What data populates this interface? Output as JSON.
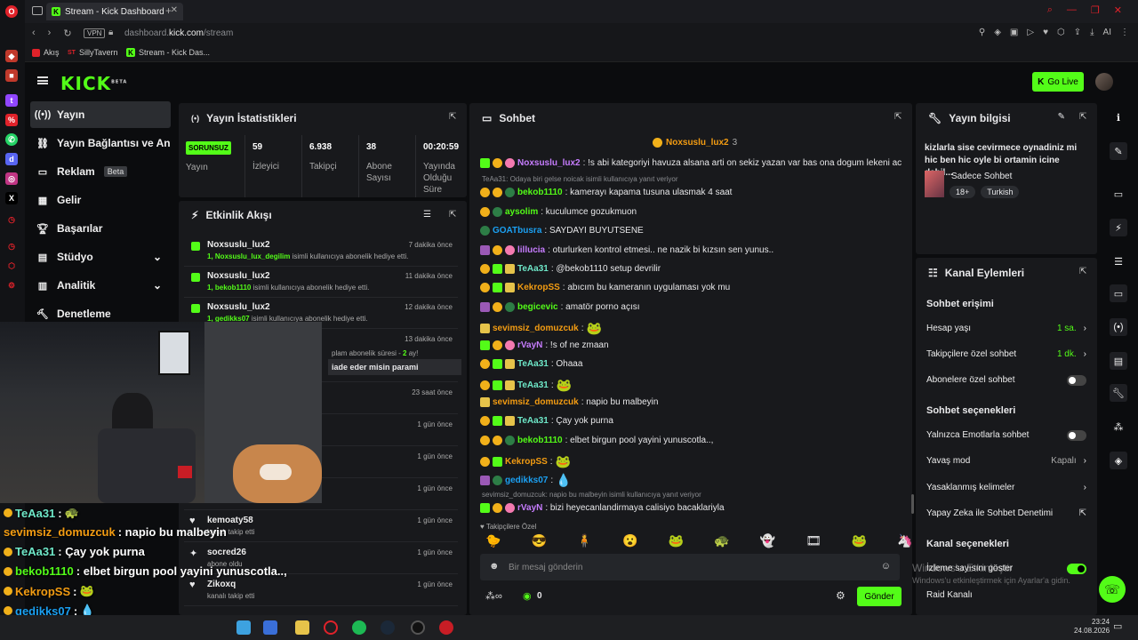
{
  "browser": {
    "tab_title": "Stream - Kick Dashboard",
    "url_host": "dashboard.",
    "url_domain": "kick.com",
    "url_path": "/stream",
    "vpn": "VPN",
    "ai": "AI",
    "bookmarks": [
      "Akış",
      "SillyTavern",
      "Stream - Kick Das..."
    ]
  },
  "header": {
    "logo": "KICK",
    "logo_sup": "BETA",
    "go_live": "Go Live"
  },
  "nav": [
    {
      "label": "Yayın",
      "icon": "broadcast-icon"
    },
    {
      "label": "Yayın Bağlantısı ve Anahtarı",
      "icon": "link-icon"
    },
    {
      "label": "Reklam",
      "icon": "ad-icon",
      "badge": "Beta"
    },
    {
      "label": "Gelir",
      "icon": "chart-icon"
    },
    {
      "label": "Başarılar",
      "icon": "trophy-icon"
    },
    {
      "label": "Stüdyo",
      "icon": "studio-icon"
    },
    {
      "label": "Analitik",
      "icon": "analytics-icon"
    },
    {
      "label": "Denetleme",
      "icon": "hammer-icon"
    }
  ],
  "stats": {
    "title": "Yayın İstatistikleri",
    "status": "SORUNSUZ",
    "status_label": "Yayın",
    "items": [
      {
        "value": "59",
        "label": "İzleyici"
      },
      {
        "value": "6.938",
        "label": "Takipçi"
      },
      {
        "value": "38",
        "label": "Abone Sayısı"
      },
      {
        "value": "00:20:59",
        "label": "Yayında Olduğu Süre"
      }
    ]
  },
  "activity": {
    "title": "Etkinlik Akışı",
    "events": [
      {
        "name": "Noxsuslu_lux2",
        "time": "7 dakika önce",
        "count": "1,",
        "who": "Noxsuslu_lux_degilim",
        "text": "isimli kullanıcıya abonelik hediye etti."
      },
      {
        "name": "Noxsuslu_lux2",
        "time": "11 dakika önce",
        "count": "1,",
        "who": "bekob1110",
        "text": "isimli kullanıcıya abonelik hediye etti."
      },
      {
        "name": "Noxsuslu_lux2",
        "time": "12 dakika önce",
        "count": "1,",
        "who": "gedikks07",
        "text": "isimli kullanıcıya abonelik hediye etti."
      }
    ],
    "partial": {
      "time": "13 dakika önce",
      "text1": "plam abonelik süresi -",
      "months": "2",
      "text2": "ay!",
      "msg": "iade eder misin parami"
    },
    "times": [
      "23 saat önce",
      "1 gün önce",
      "1 gün önce",
      "1 gün önce"
    ],
    "follows": [
      {
        "name": "kemoaty58",
        "text": "kanalı takip etti",
        "time": "1 gün önce"
      },
      {
        "name": "socred26",
        "text": "abone oldu",
        "time": "1 gün önce"
      },
      {
        "name": "Zikoxq",
        "text": "kanalı takip etti",
        "time": "1 gün önce"
      }
    ]
  },
  "chat": {
    "title": "Sohbet",
    "pinned_user": "Noxsuslu_lux2",
    "pinned_count": "3",
    "messages": [
      {
        "user": "Noxsuslu_lux2",
        "color": "#c77dff",
        "text": ": !s abi kategoriyi havuza alsana arti on sekiz yazan var bas ona dogum lekeni ac"
      },
      {
        "sys": "TeAa31: Odaya biri gelse noicak isimli kullanıcıya yanıt veriyor"
      },
      {
        "user": "bekob1110",
        "color": "#53fc18",
        "text": ": kamerayı kapama tusuna ulasmak 4 saat"
      },
      {
        "user": "aysolim",
        "color": "#53fc18",
        "text": ": kuculumce gozukmuon"
      },
      {
        "user": "GOATbusra",
        "color": "#1ba0f2",
        "text": ": SAYDAYI BUYUTSENE"
      },
      {
        "user": "lillucia",
        "color": "#c77dff",
        "text": ": oturlurken kontrol etmesi.. ne nazik bi kızsın sen yunus.."
      },
      {
        "user": "TeAa31",
        "color": "#6ee7c8",
        "text": ": @bekob1110 setup devrilir"
      },
      {
        "user": "KekropSS",
        "color": "#f39c12",
        "text": ": abıcım bu kameranın uygulaması yok mu"
      },
      {
        "user": "begicevic",
        "color": "#53fc18",
        "text": ": amatör porno açısı"
      },
      {
        "user": "sevimsiz_domuzcuk",
        "color": "#f39c12",
        "text": ":"
      },
      {
        "user": "rVayN",
        "color": "#c77dff",
        "text": ": !s of ne zmaan"
      },
      {
        "user": "TeAa31",
        "color": "#6ee7c8",
        "text": ": Ohaaa"
      },
      {
        "user": "TeAa31",
        "color": "#6ee7c8",
        "text": ":"
      },
      {
        "user": "sevimsiz_domuzcuk",
        "color": "#f39c12",
        "text": ": napio bu malbeyin"
      },
      {
        "user": "TeAa31",
        "color": "#6ee7c8",
        "text": ": Çay yok purna"
      },
      {
        "user": "bekob1110",
        "color": "#53fc18",
        "text": ": elbet birgun pool yayini yunuscotla..,"
      },
      {
        "user": "KekropSS",
        "color": "#f39c12",
        "text": ":"
      },
      {
        "user": "gedikks07",
        "color": "#1ba0f2",
        "text": ":"
      },
      {
        "sys": "sevimsiz_domuzcuk: napio bu malbeyin isimli kullanıcıya yanıt veriyor"
      },
      {
        "user": "rVayN",
        "color": "#c77dff",
        "text": ": bizi heyecanlandirmaya calisiyo bacaklariyla"
      }
    ],
    "followers_only": "Takipçilere Özel",
    "placeholder": "Bir mesaj gönderin",
    "count": "0",
    "send": "Gönder"
  },
  "info": {
    "title": "Yayın bilgisi",
    "stream_title": "kizlarla sise cevirmece oynadiniz mi hic ben hic oyle bi ortamin icine dahil...",
    "category": "Sadece Sohbet",
    "tags": [
      "18+",
      "Turkish"
    ]
  },
  "actions": {
    "title": "Kanal Eylemleri",
    "chat_access": "Sohbet erişimi",
    "rows1": [
      {
        "label": "Hesap yaşı",
        "value": "1 sa."
      },
      {
        "label": "Takipçilere özel sohbet",
        "value": "1 dk."
      },
      {
        "label": "Abonelere özel sohbet",
        "value": ""
      }
    ],
    "chat_options": "Sohbet seçenekleri",
    "rows2": [
      {
        "label": "Yalnızca Emotlarla sohbet",
        "value": ""
      },
      {
        "label": "Yavaş mod",
        "value": "Kapalı"
      },
      {
        "label": "Yasaklanmış kelimeler",
        "value": ""
      },
      {
        "label": "Yapay Zeka ile Sohbet Denetimi",
        "value": ""
      }
    ],
    "channel_options": "Kanal seçenekleri",
    "rows3": [
      {
        "label": "İzleme sayısını göster"
      },
      {
        "label": "Raid Kanalı"
      }
    ],
    "watermark1": "Windows'u Etkinleştir",
    "watermark2": "Windows'u etkinleştirmek için Ayarlar'a gidin."
  },
  "overlay": [
    {
      "user": "TeAa31",
      "color": "#6ee7c8",
      "text": ":"
    },
    {
      "user": "sevimsiz_domuzcuk",
      "color": "#f39c12",
      "text": ": napio bu malbeyin"
    },
    {
      "user": "TeAa31",
      "color": "#6ee7c8",
      "text": ": Çay yok purna"
    },
    {
      "user": "bekob1110",
      "color": "#53fc18",
      "text": ": elbet birgun pool yayini yunuscotla..,"
    },
    {
      "user": "KekropSS",
      "color": "#f39c12",
      "text": ":"
    },
    {
      "user": "gedikks07",
      "color": "#1ba0f2",
      "text": ":"
    },
    {
      "user": "rVayN",
      "color": "#c77dff",
      "text": ": bizi heyecanlandirmaya calisiyo bacaklariyla"
    }
  ],
  "taskbar": {
    "time": "23:24",
    "date": "24.08.2026"
  },
  "colors": {
    "accent": "#53fc18",
    "bg": "#0b0c0e",
    "panel": "#18191c"
  }
}
